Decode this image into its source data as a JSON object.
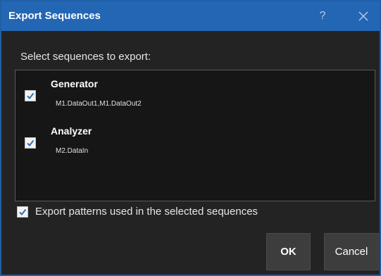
{
  "dialog": {
    "title": "Export Sequences",
    "help_symbol": "?",
    "prompt": "Select sequences to export:",
    "sequences": [
      {
        "name": "Generator",
        "detail": "M1.DataOut1,M1.DataOut2",
        "checked": true
      },
      {
        "name": "Analyzer",
        "detail": "M2.DataIn",
        "checked": true
      }
    ],
    "export_patterns": {
      "label": "Export patterns used in the selected sequences",
      "checked": true
    },
    "buttons": {
      "ok": "OK",
      "cancel": "Cancel"
    },
    "colors": {
      "title_bar": "#2366b3",
      "background": "#232323",
      "list_background": "#161616",
      "checkmark": "#2f6fb8"
    },
    "icons": {
      "help": "help-icon",
      "close": "close-icon",
      "check": "checkmark-icon"
    }
  }
}
